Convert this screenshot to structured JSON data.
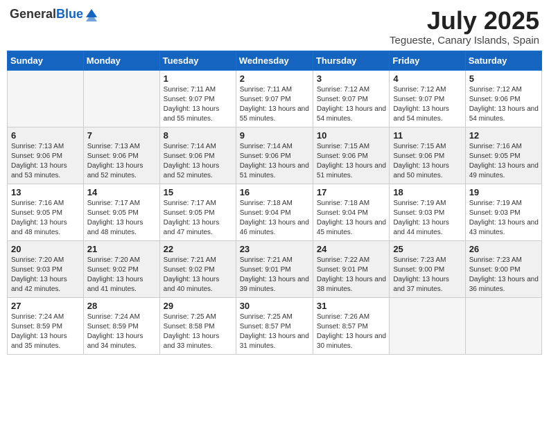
{
  "header": {
    "logo_general": "General",
    "logo_blue": "Blue",
    "month_year": "July 2025",
    "location": "Tegueste, Canary Islands, Spain"
  },
  "days_of_week": [
    "Sunday",
    "Monday",
    "Tuesday",
    "Wednesday",
    "Thursday",
    "Friday",
    "Saturday"
  ],
  "weeks": [
    [
      {
        "day": "",
        "info": ""
      },
      {
        "day": "",
        "info": ""
      },
      {
        "day": "1",
        "info": "Sunrise: 7:11 AM\nSunset: 9:07 PM\nDaylight: 13 hours and 55 minutes."
      },
      {
        "day": "2",
        "info": "Sunrise: 7:11 AM\nSunset: 9:07 PM\nDaylight: 13 hours and 55 minutes."
      },
      {
        "day": "3",
        "info": "Sunrise: 7:12 AM\nSunset: 9:07 PM\nDaylight: 13 hours and 54 minutes."
      },
      {
        "day": "4",
        "info": "Sunrise: 7:12 AM\nSunset: 9:07 PM\nDaylight: 13 hours and 54 minutes."
      },
      {
        "day": "5",
        "info": "Sunrise: 7:12 AM\nSunset: 9:06 PM\nDaylight: 13 hours and 54 minutes."
      }
    ],
    [
      {
        "day": "6",
        "info": "Sunrise: 7:13 AM\nSunset: 9:06 PM\nDaylight: 13 hours and 53 minutes."
      },
      {
        "day": "7",
        "info": "Sunrise: 7:13 AM\nSunset: 9:06 PM\nDaylight: 13 hours and 52 minutes."
      },
      {
        "day": "8",
        "info": "Sunrise: 7:14 AM\nSunset: 9:06 PM\nDaylight: 13 hours and 52 minutes."
      },
      {
        "day": "9",
        "info": "Sunrise: 7:14 AM\nSunset: 9:06 PM\nDaylight: 13 hours and 51 minutes."
      },
      {
        "day": "10",
        "info": "Sunrise: 7:15 AM\nSunset: 9:06 PM\nDaylight: 13 hours and 51 minutes."
      },
      {
        "day": "11",
        "info": "Sunrise: 7:15 AM\nSunset: 9:06 PM\nDaylight: 13 hours and 50 minutes."
      },
      {
        "day": "12",
        "info": "Sunrise: 7:16 AM\nSunset: 9:05 PM\nDaylight: 13 hours and 49 minutes."
      }
    ],
    [
      {
        "day": "13",
        "info": "Sunrise: 7:16 AM\nSunset: 9:05 PM\nDaylight: 13 hours and 48 minutes."
      },
      {
        "day": "14",
        "info": "Sunrise: 7:17 AM\nSunset: 9:05 PM\nDaylight: 13 hours and 48 minutes."
      },
      {
        "day": "15",
        "info": "Sunrise: 7:17 AM\nSunset: 9:05 PM\nDaylight: 13 hours and 47 minutes."
      },
      {
        "day": "16",
        "info": "Sunrise: 7:18 AM\nSunset: 9:04 PM\nDaylight: 13 hours and 46 minutes."
      },
      {
        "day": "17",
        "info": "Sunrise: 7:18 AM\nSunset: 9:04 PM\nDaylight: 13 hours and 45 minutes."
      },
      {
        "day": "18",
        "info": "Sunrise: 7:19 AM\nSunset: 9:03 PM\nDaylight: 13 hours and 44 minutes."
      },
      {
        "day": "19",
        "info": "Sunrise: 7:19 AM\nSunset: 9:03 PM\nDaylight: 13 hours and 43 minutes."
      }
    ],
    [
      {
        "day": "20",
        "info": "Sunrise: 7:20 AM\nSunset: 9:03 PM\nDaylight: 13 hours and 42 minutes."
      },
      {
        "day": "21",
        "info": "Sunrise: 7:20 AM\nSunset: 9:02 PM\nDaylight: 13 hours and 41 minutes."
      },
      {
        "day": "22",
        "info": "Sunrise: 7:21 AM\nSunset: 9:02 PM\nDaylight: 13 hours and 40 minutes."
      },
      {
        "day": "23",
        "info": "Sunrise: 7:21 AM\nSunset: 9:01 PM\nDaylight: 13 hours and 39 minutes."
      },
      {
        "day": "24",
        "info": "Sunrise: 7:22 AM\nSunset: 9:01 PM\nDaylight: 13 hours and 38 minutes."
      },
      {
        "day": "25",
        "info": "Sunrise: 7:23 AM\nSunset: 9:00 PM\nDaylight: 13 hours and 37 minutes."
      },
      {
        "day": "26",
        "info": "Sunrise: 7:23 AM\nSunset: 9:00 PM\nDaylight: 13 hours and 36 minutes."
      }
    ],
    [
      {
        "day": "27",
        "info": "Sunrise: 7:24 AM\nSunset: 8:59 PM\nDaylight: 13 hours and 35 minutes."
      },
      {
        "day": "28",
        "info": "Sunrise: 7:24 AM\nSunset: 8:59 PM\nDaylight: 13 hours and 34 minutes."
      },
      {
        "day": "29",
        "info": "Sunrise: 7:25 AM\nSunset: 8:58 PM\nDaylight: 13 hours and 33 minutes."
      },
      {
        "day": "30",
        "info": "Sunrise: 7:25 AM\nSunset: 8:57 PM\nDaylight: 13 hours and 31 minutes."
      },
      {
        "day": "31",
        "info": "Sunrise: 7:26 AM\nSunset: 8:57 PM\nDaylight: 13 hours and 30 minutes."
      },
      {
        "day": "",
        "info": ""
      },
      {
        "day": "",
        "info": ""
      }
    ]
  ]
}
